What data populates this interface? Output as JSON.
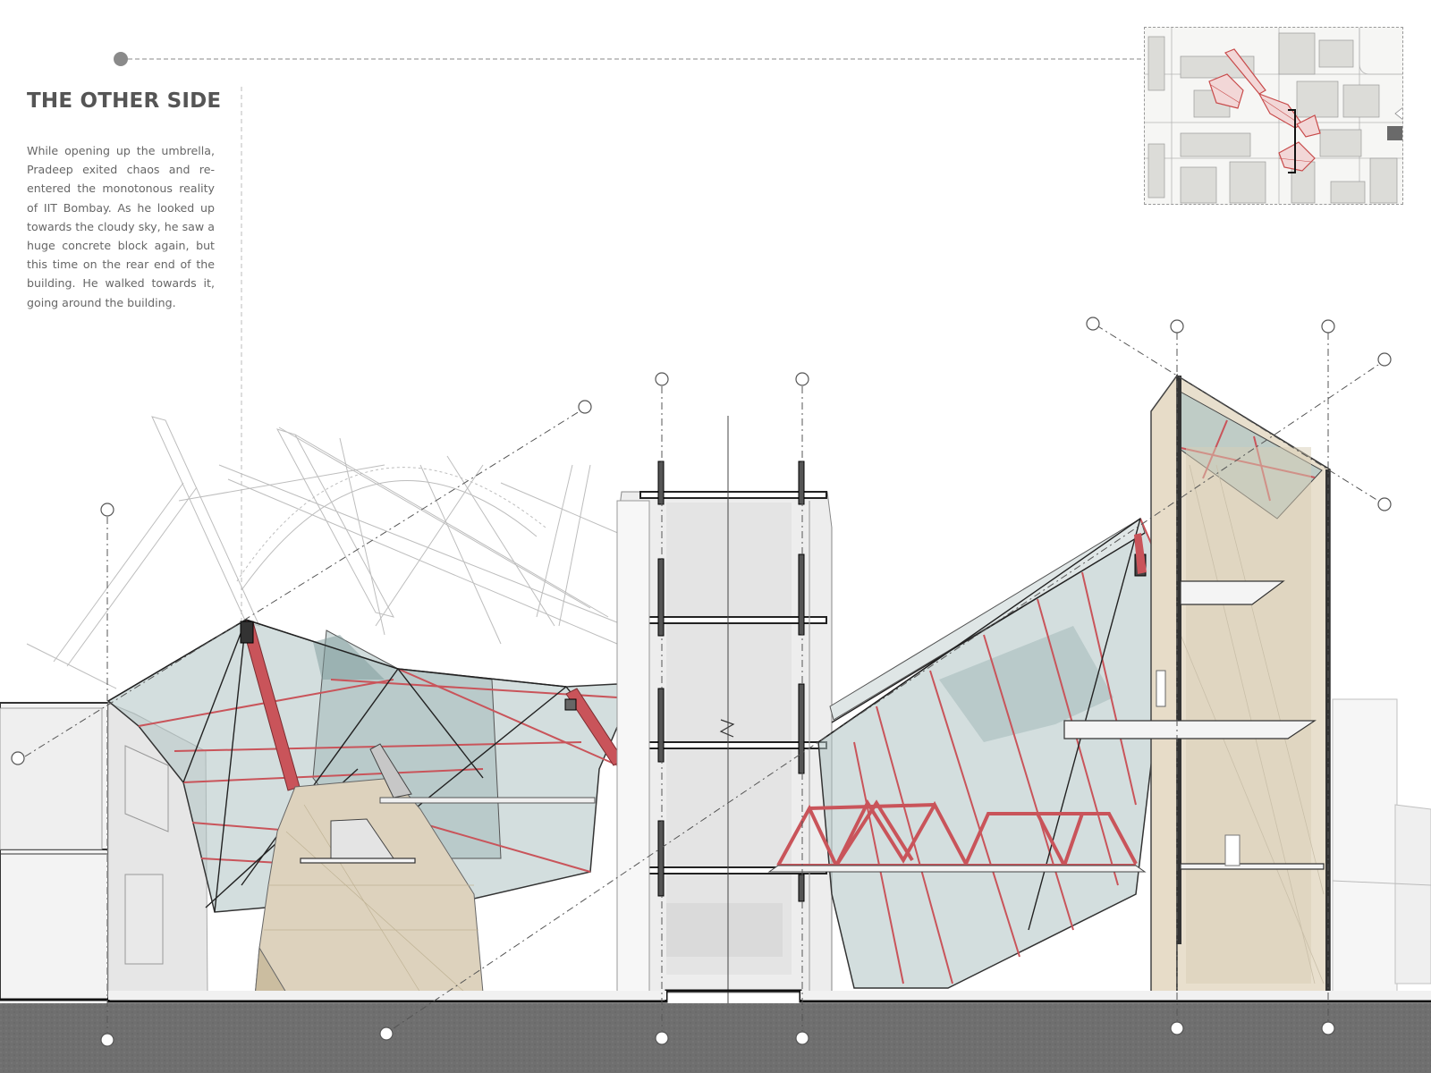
{
  "heading": "THE OTHER SIDE",
  "paragraph": "While opening up the umbrella, Pradeep exited chaos and re-entered the monotonous reality of IIT Bombay. As he looked up towards the cloudy sky, he saw a huge concrete block again, but this time on the rear end of the building. He walked towards it, going around the building.",
  "colors": {
    "ground": "#6f6f6f",
    "glass": "#aec3c3",
    "steel_red": "#c9545a",
    "wood": "#d9cdb5",
    "wall_line": "#333333",
    "keymap_block": "#dcdcd8",
    "keymap_red": "#c84a4a"
  },
  "icons": [
    "grid-bubble-icon",
    "grid-line",
    "keymap"
  ]
}
